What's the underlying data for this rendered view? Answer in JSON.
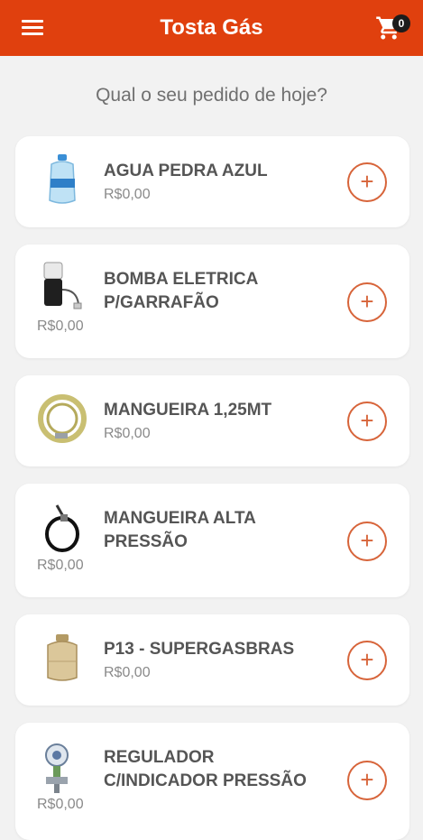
{
  "header": {
    "title": "Tosta Gás",
    "cart_count": "0",
    "brand_color": "#e0400e"
  },
  "page": {
    "question": "Qual o seu pedido de hoje?"
  },
  "products": [
    {
      "name": "AGUA PEDRA AZUL",
      "price": "R$0,00",
      "icon": "water-jug-icon",
      "add_label": "+"
    },
    {
      "name": "BOMBA ELETRICA P/GARRAFÃO",
      "price": "R$0,00",
      "icon": "electric-pump-icon",
      "add_label": "+"
    },
    {
      "name": "MANGUEIRA 1,25MT",
      "price": "R$0,00",
      "icon": "hose-icon",
      "add_label": "+"
    },
    {
      "name": "MANGUEIRA ALTA PRESSÃO",
      "price": "R$0,00",
      "icon": "high-pressure-hose-icon",
      "add_label": "+"
    },
    {
      "name": "P13 - SUPERGASBRAS",
      "price": "R$0,00",
      "icon": "gas-cylinder-icon",
      "add_label": "+"
    },
    {
      "name": "REGULADOR C/INDICADOR PRESSÃO",
      "price": "R$0,00",
      "icon": "pressure-regulator-icon",
      "add_label": "+"
    }
  ]
}
